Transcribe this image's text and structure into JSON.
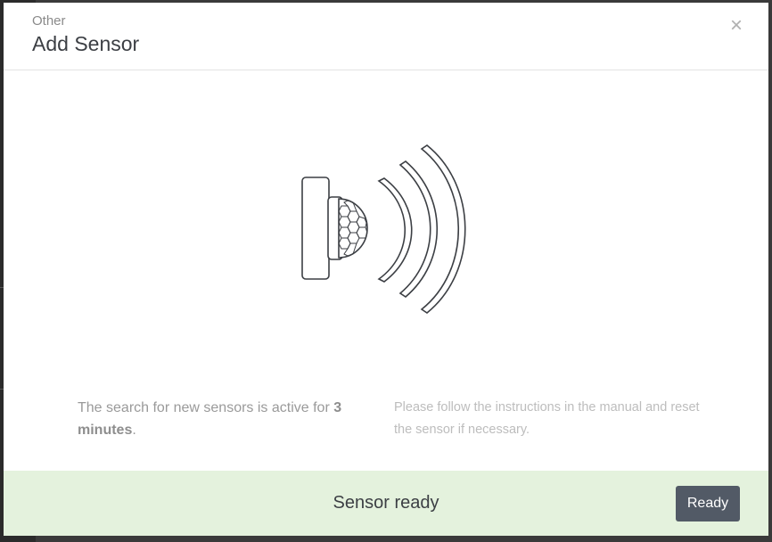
{
  "dialog": {
    "subtitle": "Other",
    "title": "Add Sensor",
    "close_label": "×"
  },
  "illustration": {
    "icon": "motion-sensor-icon"
  },
  "info": {
    "search_text_prefix": "The search for new sensors is active for",
    "search_duration": "3 minutes",
    "search_text_suffix": ".",
    "instructions": "Please follow the instructions in the manual and reset the sensor if necessary."
  },
  "footer": {
    "status": "Sensor ready",
    "ready_label": "Ready",
    "background": "#e4f2dd",
    "button_color": "#525a66"
  }
}
